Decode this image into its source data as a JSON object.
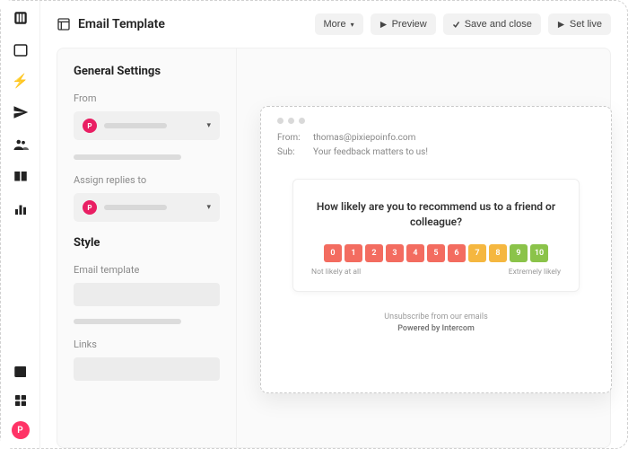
{
  "title": "Email Template",
  "actions": {
    "more": "More",
    "preview": "Preview",
    "save": "Save and close",
    "setlive": "Set live"
  },
  "settings": {
    "heading": "General Settings",
    "from_label": "From",
    "assign_label": "Assign replies to",
    "style_heading": "Style",
    "template_label": "Email template",
    "links_label": "Links",
    "avatar_initial": "P"
  },
  "email": {
    "from_label": "From:",
    "from_value": "thomas@pixiepoinfo.com",
    "sub_label": "Sub:",
    "sub_value": "Your feedback matters to us!",
    "question": "How likely are you to recommend us to a friend or colleague?",
    "scale": [
      {
        "n": "0",
        "c": "#F36C60"
      },
      {
        "n": "1",
        "c": "#F36C60"
      },
      {
        "n": "2",
        "c": "#F36C60"
      },
      {
        "n": "3",
        "c": "#F36C60"
      },
      {
        "n": "4",
        "c": "#F36C60"
      },
      {
        "n": "5",
        "c": "#F36C60"
      },
      {
        "n": "6",
        "c": "#F36C60"
      },
      {
        "n": "7",
        "c": "#F5B740"
      },
      {
        "n": "8",
        "c": "#F5B740"
      },
      {
        "n": "9",
        "c": "#8BC34A"
      },
      {
        "n": "10",
        "c": "#8BC34A"
      }
    ],
    "low_label": "Not likely at all",
    "high_label": "Extremely likely",
    "unsubscribe": "Unsubscribe from our emails",
    "powered": "Powered by Intercom"
  }
}
